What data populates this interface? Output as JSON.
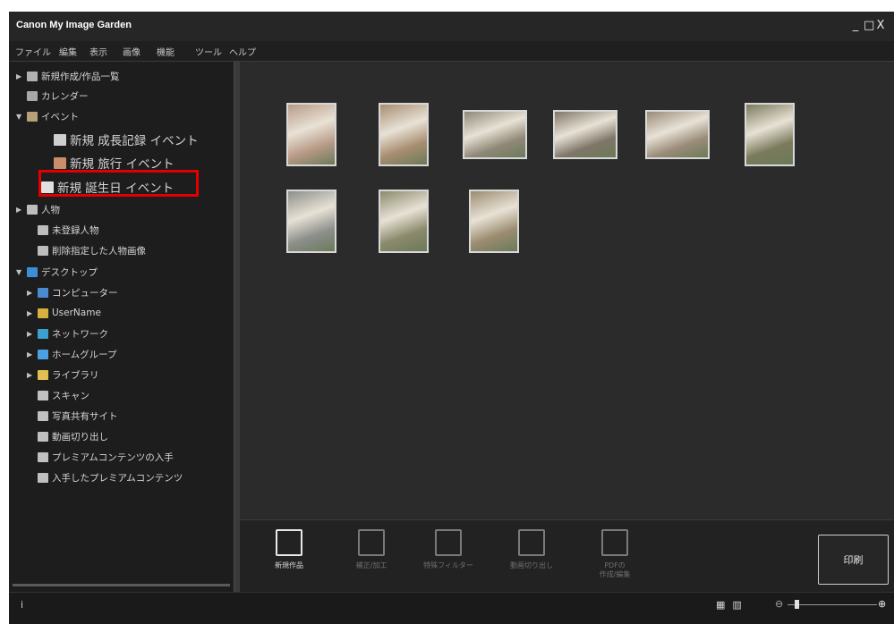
{
  "app": {
    "title": "Canon My Image Garden",
    "controls": [
      "_",
      "□",
      "X"
    ]
  },
  "menu": [
    "ファイル",
    "編集",
    "表示",
    "画像",
    "機能",
    "ツール",
    "ヘルプ"
  ],
  "sidebar": {
    "items": [
      {
        "label": "新規作成/作品一覧",
        "arrow": "▶",
        "icon": "new-work-icon"
      },
      {
        "label": "カレンダー",
        "arrow": "",
        "icon": "calendar-icon"
      },
      {
        "label": "イベント",
        "arrow": "▼",
        "icon": "event-icon"
      },
      {
        "label": "新規 成長記録 イベント",
        "arrow": "",
        "icon": "growth-record-icon"
      },
      {
        "label": "新規 旅行 イベント",
        "arrow": "",
        "icon": "travel-icon"
      },
      {
        "label": "新規 誕生日 イベント",
        "arrow": "",
        "icon": "birthday-icon"
      },
      {
        "label": "人物",
        "arrow": "▶",
        "icon": "person-icon"
      },
      {
        "label": "未登録人物",
        "arrow": "",
        "icon": "unregistered-person-icon"
      },
      {
        "label": "削除指定した人物画像",
        "arrow": "",
        "icon": "deleted-person-icon"
      },
      {
        "label": "デスクトップ",
        "arrow": "▼",
        "icon": "desktop-icon"
      },
      {
        "label": "コンピューター",
        "arrow": "▶",
        "icon": "computer-icon"
      },
      {
        "label": "UserName",
        "arrow": "▶",
        "icon": "user-folder-icon"
      },
      {
        "label": "ネットワーク",
        "arrow": "▶",
        "icon": "network-icon"
      },
      {
        "label": "ホームグループ",
        "arrow": "▶",
        "icon": "homegroup-icon"
      },
      {
        "label": "ライブラリ",
        "arrow": "▶",
        "icon": "library-icon"
      },
      {
        "label": "スキャン",
        "arrow": "",
        "icon": "scan-icon"
      },
      {
        "label": "写真共有サイト",
        "arrow": "",
        "icon": "photo-sharing-icon"
      },
      {
        "label": "動画切り出し",
        "arrow": "",
        "icon": "video-capture-icon"
      },
      {
        "label": "プレミアムコンテンツの入手",
        "arrow": "",
        "icon": "premium-download-icon"
      },
      {
        "label": "入手したプレミアムコンテンツ",
        "arrow": "",
        "icon": "premium-folder-icon"
      }
    ]
  },
  "thumbnails": [
    {
      "name": "photo-1",
      "color": "#b89a86"
    },
    {
      "name": "photo-2",
      "color": "#a88d70"
    },
    {
      "name": "photo-3",
      "color": "#8f8877"
    },
    {
      "name": "photo-4",
      "color": "#7f7668"
    },
    {
      "name": "photo-5",
      "color": "#9a8b78"
    },
    {
      "name": "photo-6",
      "color": "#7b7a5c"
    },
    {
      "name": "photo-7",
      "color": "#8c8f8a"
    },
    {
      "name": "photo-8",
      "color": "#8b8a6c"
    },
    {
      "name": "photo-9",
      "color": "#9b8c70"
    }
  ],
  "toolbar": {
    "tools": [
      {
        "label": "新規作品",
        "enabled": true
      },
      {
        "label": "補正/加工",
        "enabled": false
      },
      {
        "label": "特殊フィルター",
        "enabled": false
      },
      {
        "label": "動画切り出し",
        "enabled": false
      },
      {
        "label": "PDFの\n作成/編集",
        "enabled": false
      }
    ],
    "print_label": "印刷"
  },
  "status": {
    "info": "i",
    "view_icons": [
      "▦",
      "▥"
    ],
    "zoom_out": "⊖",
    "zoom_in": "⊕"
  },
  "colors": {
    "background": "#2b2b2b",
    "sidebar": "#1d1d1d",
    "highlight": "#e00000"
  }
}
